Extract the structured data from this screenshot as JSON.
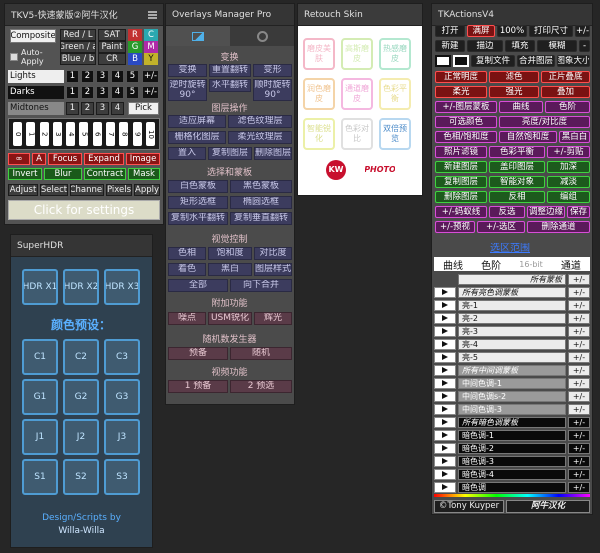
{
  "tkv5": {
    "title": "TKV5-快速蒙版②阿牛汉化",
    "composite": "Composite",
    "auto_apply": "Auto-Apply",
    "channels": [
      [
        "Red / L",
        "SAT",
        "R",
        "C"
      ],
      [
        "Green / a",
        "Paint",
        "G",
        "M"
      ],
      [
        "Blue / b",
        "CR",
        "B",
        "Y"
      ]
    ],
    "lights": "Lights",
    "darks": "Darks",
    "midtones": "Midtones",
    "nums": [
      "1",
      "2",
      "3",
      "4",
      "5"
    ],
    "plusminus": "+/-",
    "pick": "Pick",
    "zone_nums": [
      "0",
      "1",
      "2",
      "3",
      "4",
      "5",
      "6",
      "7",
      "8",
      "9",
      "10"
    ],
    "row_a": [
      "∞",
      "A",
      "Focus",
      "Expand",
      "Image"
    ],
    "row_b": [
      "Invert",
      "Blur",
      "Contract",
      "Mask"
    ],
    "row_c": [
      "Adjust",
      "Select",
      "Channel",
      "Pixels",
      "Apply"
    ],
    "settings": "Click for settings"
  },
  "superhdr": {
    "title": "SuperHDR",
    "hdr": [
      "HDR X1",
      "HDR X2",
      "HDR X3"
    ],
    "preset_label": "颜色预设：",
    "presets": [
      "C1",
      "C2",
      "C3",
      "G1",
      "G2",
      "G3",
      "J1",
      "J2",
      "J3",
      "S1",
      "S2",
      "S3"
    ],
    "credit1": "Design/Scripts by",
    "credit2": "Willa-Willa"
  },
  "overlays": {
    "title": "Overlays Manager Pro",
    "s_transform": "变换",
    "transform": [
      "变换",
      "重置翻转",
      "变形",
      "逆时旋转90°",
      "水平翻转",
      "顺时旋转90°"
    ],
    "s_layerop": "图层操作",
    "layerop": [
      "适应屏幕",
      "滤色纹理层",
      "栅格化图层",
      "柔光纹理层",
      "置入",
      "复制图层",
      "删除图层"
    ],
    "s_select": "选择和蒙板",
    "select": [
      "白色蒙板",
      "黑色蒙板",
      "矩形选框",
      "椭圆选框",
      "复制水平翻转",
      "复制垂直翻转"
    ],
    "s_view": "视觉控制",
    "view": [
      "色相",
      "饱和度",
      "对比度",
      "着色",
      "黑白",
      "图层样式",
      "全部",
      "向下合并"
    ],
    "s_extra": "附加功能",
    "extra": [
      "噪点",
      "USM锐化",
      "辉光"
    ],
    "s_random": "随机数发生器",
    "random": [
      "预备",
      "随机"
    ],
    "s_vfunc": "视频功能",
    "vfunc": [
      "1 预备",
      "2 预选"
    ]
  },
  "retouch": {
    "title": "Retouch Skin",
    "cells": [
      "磨皮美肤",
      "高斯磨皮",
      "热感磨皮",
      "润色磨皮",
      "通道磨皮",
      "色彩平衡",
      "智能锐化",
      "色彩对比",
      "双倍预览"
    ],
    "logo": "KW",
    "photo": "PHOTO"
  },
  "tka": {
    "title": "TKActionsV4",
    "top1": [
      "打开",
      "满屏",
      "100%",
      "打印尺寸",
      "+/-"
    ],
    "top2": [
      "新建",
      "描边",
      "填充",
      "模糊",
      "-"
    ],
    "top3": [
      "复制文件",
      "合并图层",
      "图象大小"
    ],
    "grid": [
      [
        "正常明度",
        "滤色",
        "正片叠底"
      ],
      [
        "柔光",
        "强光",
        "叠加"
      ],
      [
        "+/-图层蒙板",
        "曲线",
        "色阶"
      ],
      [
        "可选颜色",
        "亮度/对比度"
      ],
      [
        "色相/饱和度",
        "自然饱和度",
        "黑白白"
      ],
      [
        "照片滤镜",
        "色彩平衡",
        "+/-剪贴"
      ],
      [
        "新建图层",
        "盖印图层",
        "加深"
      ],
      [
        "复制图层",
        "智能对象",
        "减淡"
      ],
      [
        "删除图层",
        "反相",
        "编组"
      ],
      [
        "+/-蚂蚁线",
        "反选",
        "调整边缘",
        "保存"
      ],
      [
        "+/-预视",
        "+/-选区",
        "删除通道"
      ]
    ],
    "link": "选区范围",
    "tabs": [
      "曲线",
      "色阶",
      "16-bit",
      "通道"
    ],
    "sec_all": "所有蒙板",
    "sec_bright": "所有亮色调蒙板",
    "bright": [
      "亮-1",
      "亮-2",
      "亮-3",
      "亮-4",
      "亮-5"
    ],
    "sec_mid": "所有中间调蒙板",
    "mid": [
      "中间色调-1",
      "中间色调s-2",
      "中间色调-3"
    ],
    "sec_dark": "所有暗色调蒙板",
    "dark": [
      "暗色调-1",
      "暗色调-2",
      "暗色调-3",
      "暗色调-4",
      "暗色调"
    ],
    "pm": "+/-",
    "footer1": "©Tony Kuyper",
    "footer2": "阿牛汉化"
  }
}
